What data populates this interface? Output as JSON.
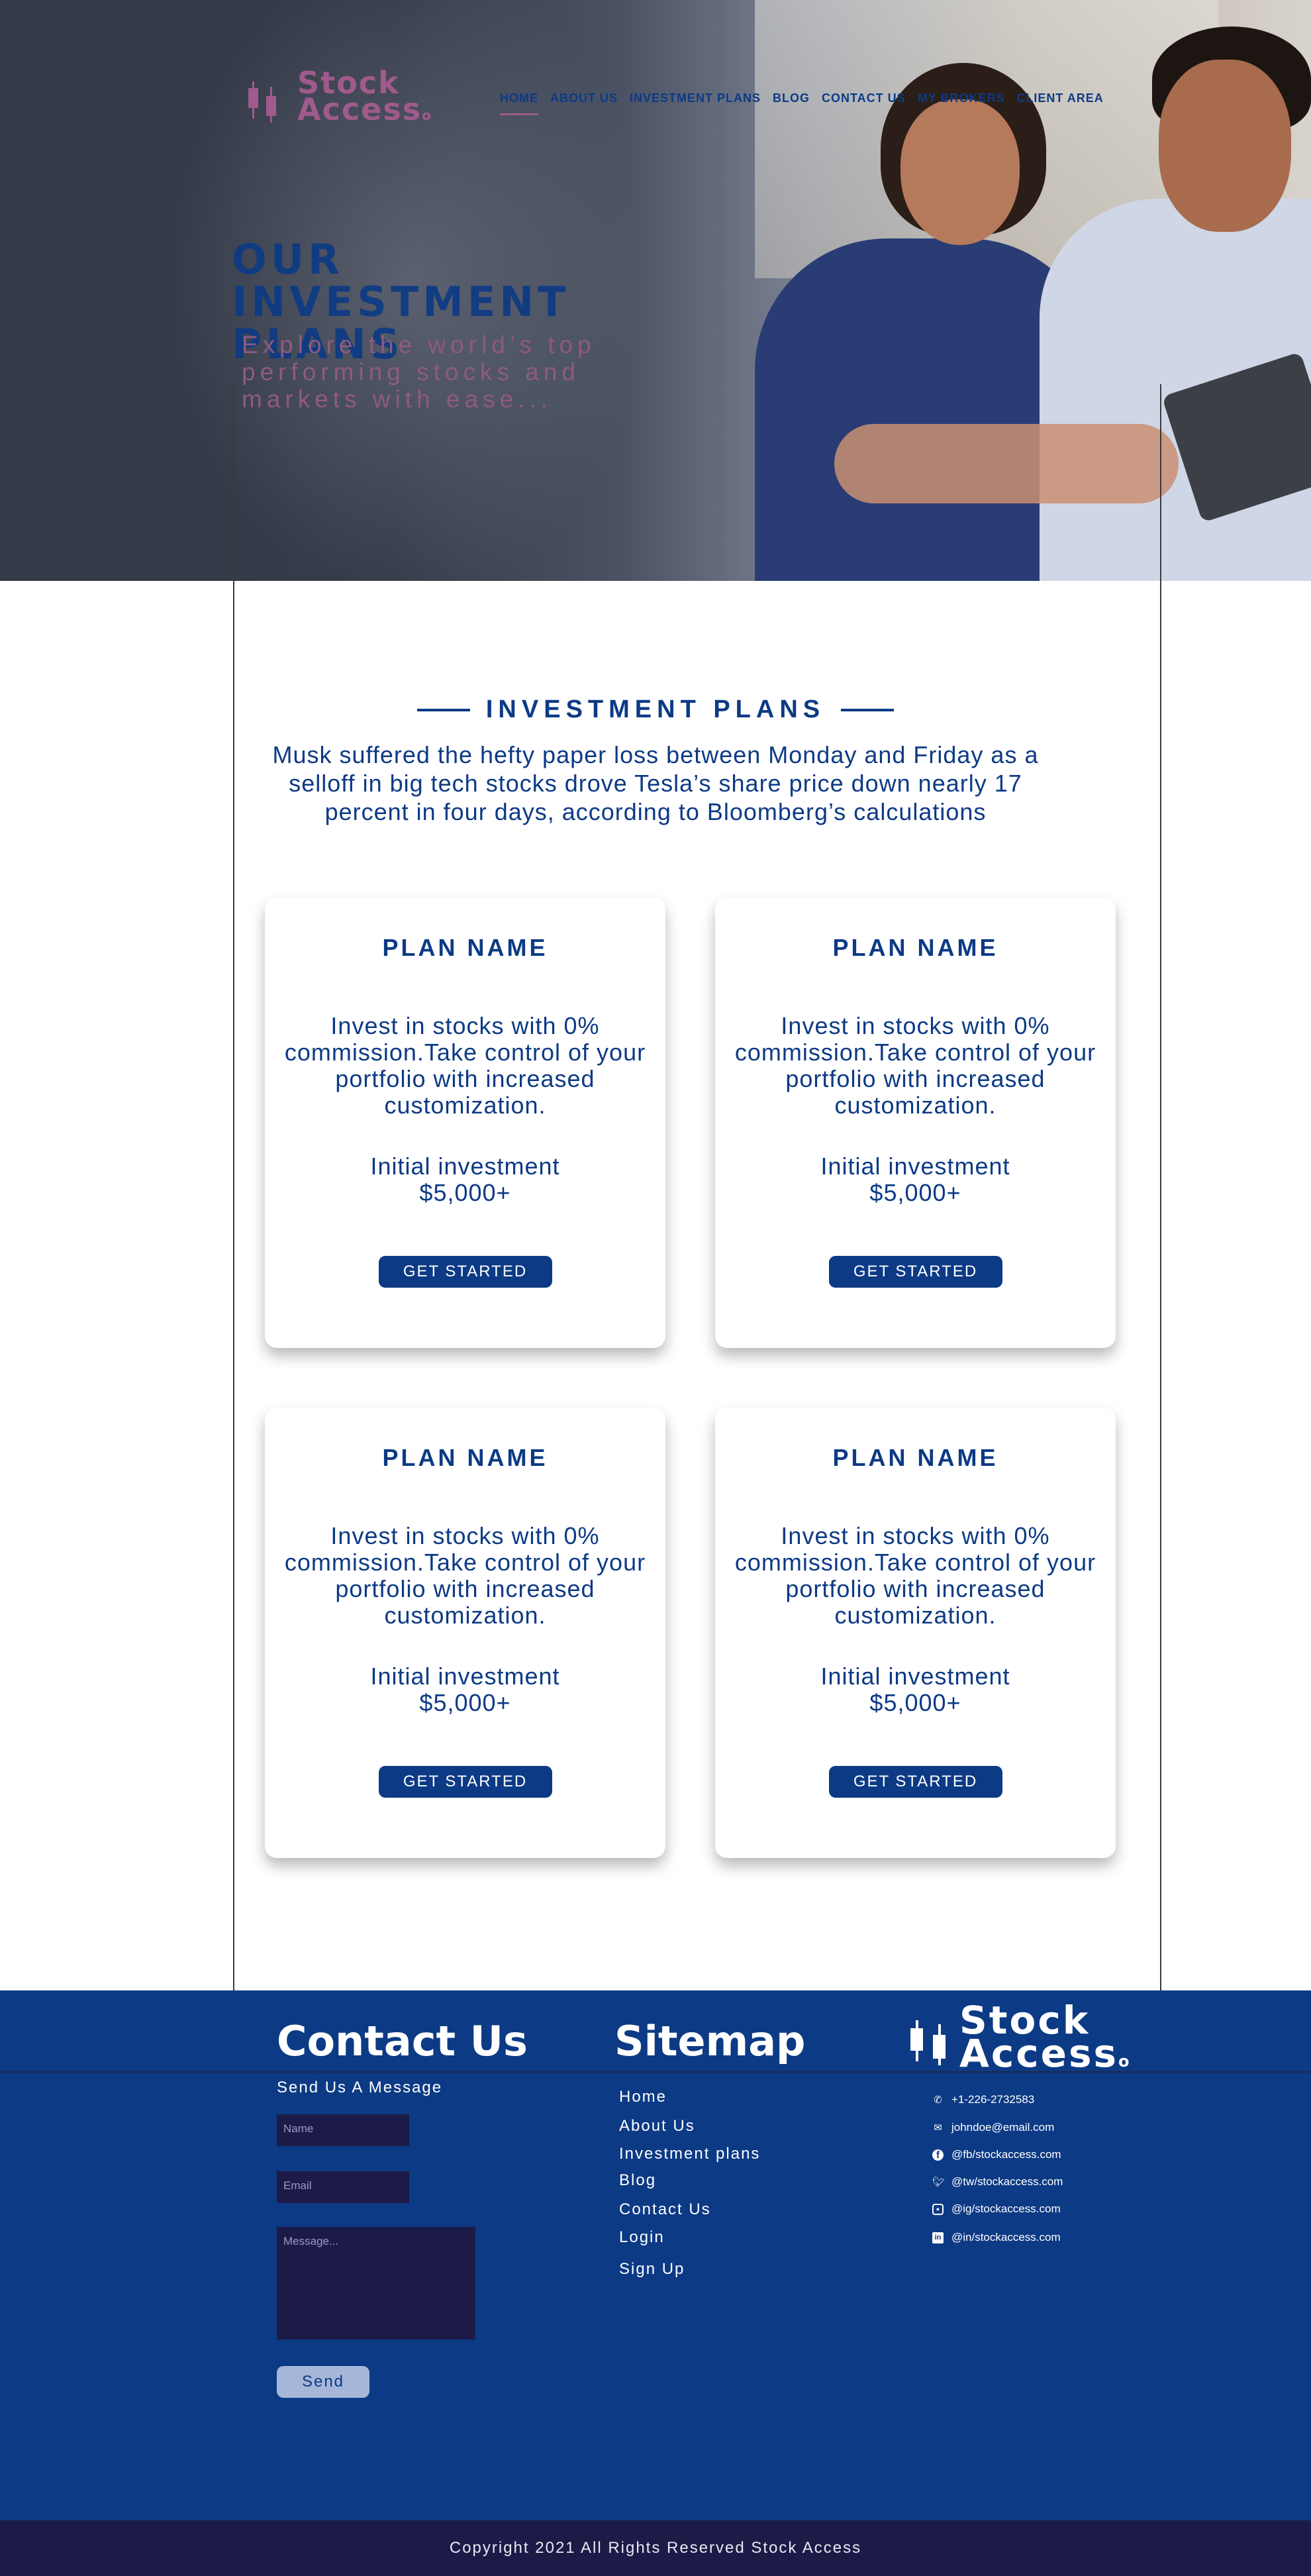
{
  "brand": {
    "line1": "Stock",
    "line2": "Access"
  },
  "nav": {
    "items": [
      "HOME",
      "ABOUT US",
      "INVESTMENT PLANS",
      "BLOG",
      "CONTACT US",
      "MY BROKERS",
      "CLIENT AREA"
    ],
    "active_index": 0
  },
  "hero": {
    "title": "OUR INVESTMENT PLANS",
    "subtitle": "Explore the world’s top performing stocks and markets with ease..."
  },
  "plans_section": {
    "title": "INVESTMENT PLANS",
    "intro": "Musk suffered the hefty paper loss between Monday and Friday as a selloff in big tech stocks drove Tesla’s share price down nearly 17 percent in four days, according to Bloomberg’s calculations"
  },
  "plans": [
    {
      "name": "PLAN NAME",
      "description": "Invest in stocks with 0% commission.Take control of your portfolio with increased customization.",
      "investment_label": "Initial investment",
      "investment_value": "$5,000+",
      "button": "GET STARTED"
    },
    {
      "name": "PLAN NAME",
      "description": "Invest in stocks with 0% commission.Take control of your portfolio with increased customization.",
      "investment_label": "Initial investment",
      "investment_value": "$5,000+",
      "button": "GET STARTED"
    },
    {
      "name": "PLAN NAME",
      "description": "Invest in stocks with 0% commission.Take control of your portfolio with increased customization.",
      "investment_label": "Initial investment",
      "investment_value": "$5,000+",
      "button": "GET STARTED"
    },
    {
      "name": "PLAN NAME",
      "description": "Invest in stocks with 0% commission.Take control of your portfolio with increased customization.",
      "investment_label": "Initial investment",
      "investment_value": "$5,000+",
      "button": "GET STARTED"
    }
  ],
  "footer": {
    "contact": {
      "title": "Contact Us",
      "subtitle": "Send Us A Message",
      "name_placeholder": "Name",
      "email_placeholder": "Email",
      "message_placeholder": "Message...",
      "send_label": "Send"
    },
    "sitemap": {
      "title": "Sitemap",
      "links": [
        "Home",
        "About Us",
        "Investment plans",
        "Blog",
        "Contact Us",
        "Login",
        "Sign Up"
      ]
    },
    "contacts": [
      {
        "icon": "phone-icon",
        "text": "+1-226-2732583"
      },
      {
        "icon": "mail-icon",
        "text": "johndoe@email.com"
      },
      {
        "icon": "facebook-icon",
        "text": "@fb/stockaccess.com"
      },
      {
        "icon": "twitter-icon",
        "text": "@tw/stockaccess.com"
      },
      {
        "icon": "instagram-icon",
        "text": "@ig/stockaccess.com"
      },
      {
        "icon": "linkedin-icon",
        "text": "@in/stockaccess.com"
      }
    ],
    "copyright": "Copyright 2021 All Rights Reserved Stock Access"
  },
  "colors": {
    "primary": "#0c3a85",
    "accent": "#a05a8c",
    "dark": "#1c1b47",
    "hero_bg": "#343a48"
  }
}
